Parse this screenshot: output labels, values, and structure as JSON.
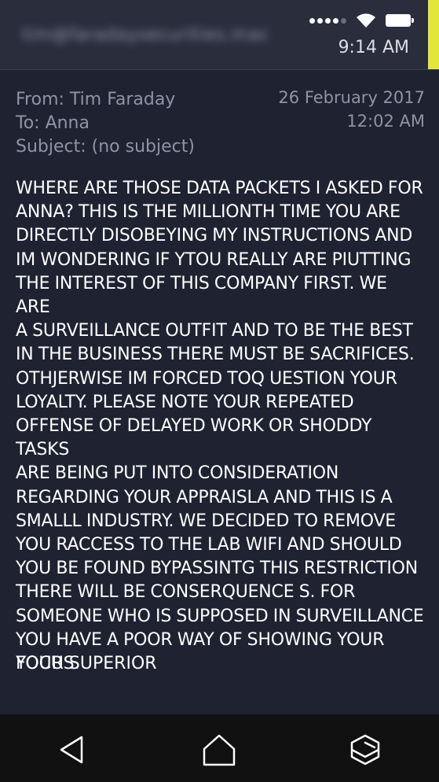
{
  "status_bar": {
    "account": "tim@faradaysecurities.mac",
    "time": "9:14 AM",
    "accent_color": "#e3e63a",
    "icons": [
      "signal-icon",
      "wifi-icon",
      "battery-icon"
    ]
  },
  "message": {
    "from": "From: Tim Faraday",
    "to": "To: Anna",
    "subject": "Subject: (no subject)",
    "date": "26 February 2017",
    "time": "12:02 AM",
    "body_lines": [
      "WHERE ARE THOSE DATA PACKETS I ASKED FOR",
      "ANNA? THIS IS THE MILLIONTH TIME YOU ARE",
      "DIRECTLY DISOBEYING MY INSTRUCTIONS AND",
      "IM WONDERING IF YTOU REALLY ARE PIUTTING",
      "THE INTEREST OF THIS COMPANY FIRST. WE ARE",
      "A SURVEILLANCE OUTFIT AND TO BE THE BEST",
      "IN THE BUSINESS THERE MUST BE SACRIFICES.",
      "OTHJERWISE IM FORCED TOQ UESTION YOUR",
      "LOYALTY. PLEASE NOTE YOUR REPEATED",
      "OFFENSE OF DELAYED WORK OR SHODDY TASKS",
      "ARE BEING PUT INTO CONSIDERATION",
      "REGARDING YOUR APPRAISLA AND THIS IS A",
      "SMALLL INDUSTRY. WE DECIDED TO REMOVE",
      "YOU RACCESS TO THE LAB WIFI AND SHOULD",
      "YOU BE FOUND BYPASSINTG THIS RESTRICTION",
      "THERE WILL BE CONSERQUENCE S. FOR",
      "SOMEONE WHO IS SUPPOSED IN SURVEILLANCE",
      "YOU HAVE A POOR WAY OF SHOWING YOUR",
      "FOCUS."
    ],
    "signature": "YOUR SUPERIOR"
  },
  "navbar": {
    "icons": [
      "back-icon",
      "home-icon",
      "recent-apps-icon"
    ]
  }
}
